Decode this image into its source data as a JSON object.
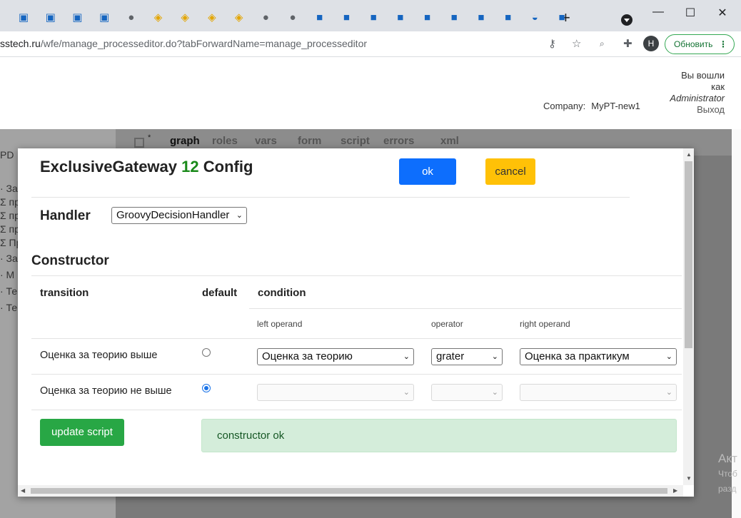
{
  "browser": {
    "tabs": [
      {
        "icon": "document-icon"
      },
      {
        "icon": "document-icon"
      },
      {
        "icon": "document-icon"
      },
      {
        "icon": "document-icon"
      },
      {
        "icon": "globe-icon"
      },
      {
        "icon": "shield-icon"
      },
      {
        "icon": "shield-icon"
      },
      {
        "icon": "shield-icon"
      },
      {
        "icon": "shield-icon"
      },
      {
        "icon": "globe-icon"
      },
      {
        "icon": "globe-icon"
      },
      {
        "icon": "app-icon"
      },
      {
        "icon": "app-icon"
      },
      {
        "icon": "app-icon"
      },
      {
        "icon": "app-icon"
      },
      {
        "icon": "app-icon"
      },
      {
        "icon": "app-icon"
      },
      {
        "icon": "app-icon"
      },
      {
        "icon": "app-icon"
      },
      {
        "icon": "swoosh-icon"
      },
      {
        "icon": "app-icon"
      }
    ],
    "new_tab": "+",
    "url_host": "sstech.ru",
    "url_path": "/wfe/manage_processeditor.do?tabForwardName=manage_processeditor",
    "avatar_letter": "H",
    "update_label": "Обновить"
  },
  "header": {
    "login_line1": "Вы вошли",
    "login_line2": "как",
    "user": "Administrator",
    "logout": "Выход",
    "company_label": "Company:",
    "company_value": "MyPT-new1"
  },
  "left_panel": {
    "items": [
      "PD",
      "· За",
      "Σ пр",
      "Σ пр",
      "Σ пр",
      "Σ Пр",
      "· За",
      "· М",
      "· Те",
      "· Те"
    ]
  },
  "editor_tabs": [
    "graph",
    "roles",
    "vars",
    "form",
    "script",
    "errors",
    "xml"
  ],
  "editor_modified_mark": "*",
  "watermark": {
    "line1": "Акт",
    "line2": "Чтоб",
    "line3": "разд"
  },
  "modal": {
    "title_prefix": "ExclusiveGateway",
    "title_number": "12",
    "title_suffix": "Config",
    "ok_label": "ok",
    "cancel_label": "cancel",
    "handler_label": "Handler",
    "handler_value": "GroovyDecisionHandler",
    "constructor_heading": "Constructor",
    "columns": {
      "transition": "transition",
      "default": "default",
      "condition": "condition",
      "left_operand": "left operand",
      "operator": "operator",
      "right_operand": "right operand"
    },
    "rows": [
      {
        "transition": "Оценка за теорию выше",
        "default": false,
        "left": "Оценка за теорию",
        "operator": "grater",
        "right": "Оценка за практикум"
      },
      {
        "transition": "Оценка за теорию не выше",
        "default": true,
        "left": "",
        "operator": "",
        "right": ""
      }
    ],
    "update_label": "update script",
    "status_message": "constructor ok"
  }
}
